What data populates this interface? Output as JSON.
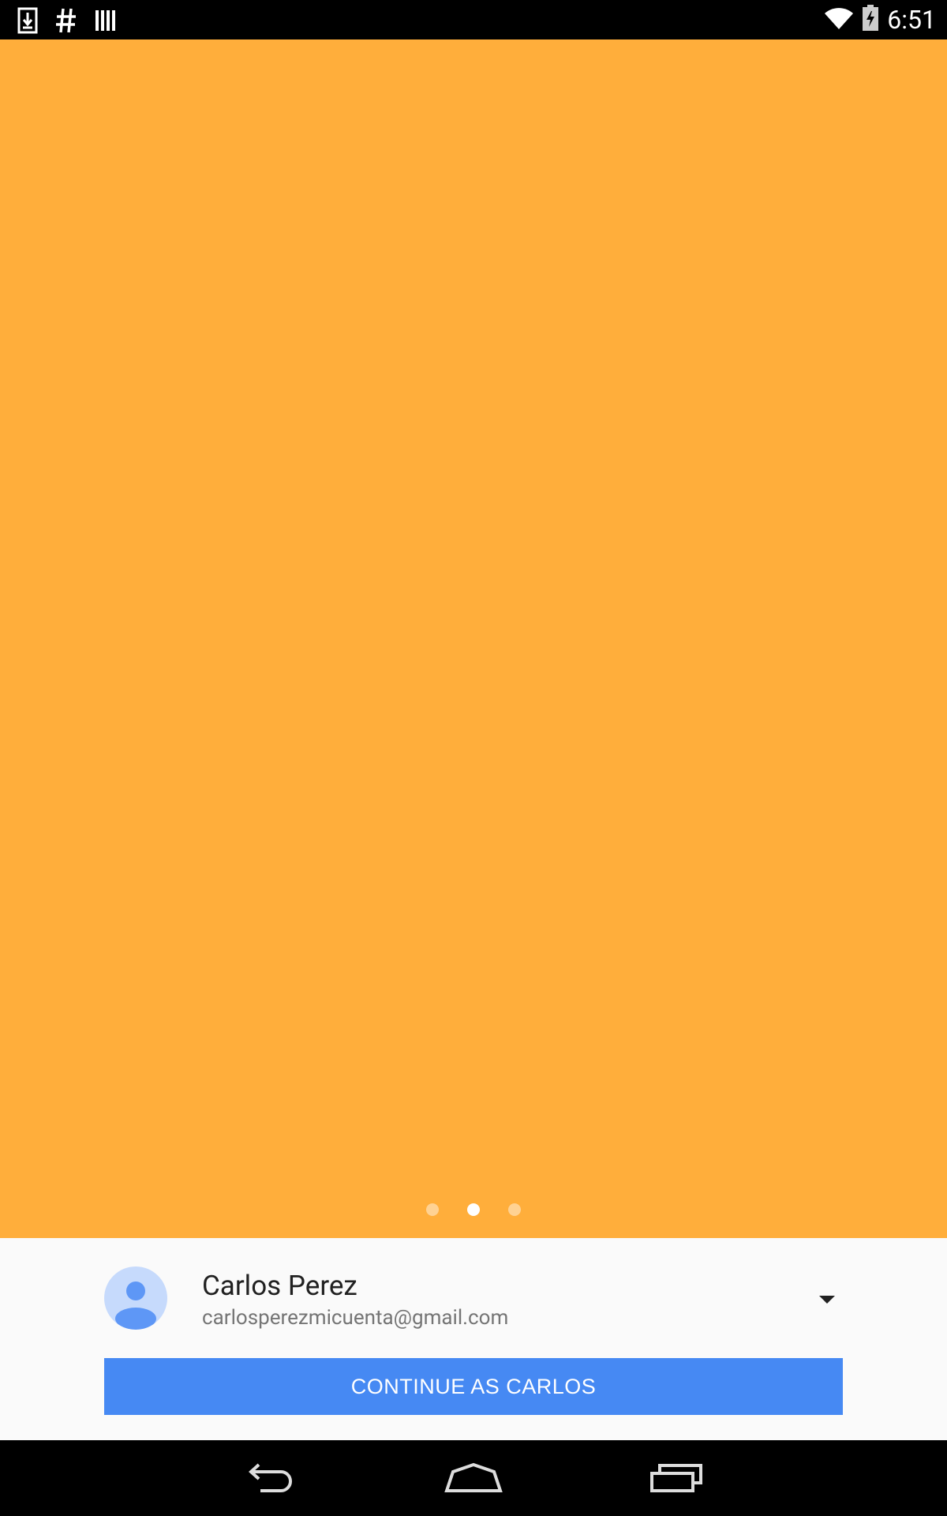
{
  "status_bar": {
    "time": "6:51",
    "left_icons": [
      "download-icon",
      "hash-icon",
      "barcode-icon"
    ],
    "right_icons": [
      "wifi-icon",
      "battery-charging-icon"
    ]
  },
  "hero": {
    "background_color": "#ffae3b",
    "pager": {
      "count": 3,
      "active_index": 1
    }
  },
  "account": {
    "name": "Carlos Perez",
    "email": "carlosperezmicuenta@gmail.com"
  },
  "continue_button": {
    "label": "CONTINUE AS CARLOS",
    "color": "#4689f3"
  },
  "nav_bar": {
    "icons": [
      "back-icon",
      "home-icon",
      "recents-icon"
    ]
  }
}
